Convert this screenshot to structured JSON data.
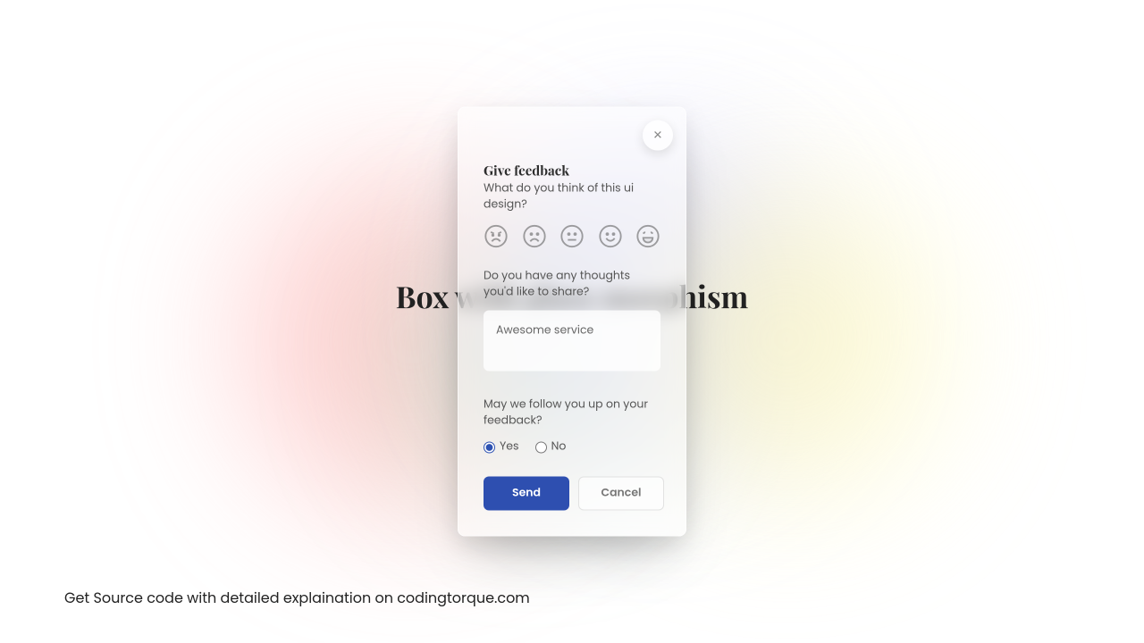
{
  "bg": {
    "title": "Box with glass morphism"
  },
  "modal": {
    "title": "Give feedback",
    "subtitle": "What do you think of this ui design?",
    "thoughts_q": "Do you have any thoughts you'd like to share?",
    "thoughts_value": "Awesome service",
    "followup_q": "May we follow you up on your feedback?",
    "radio": {
      "yes": "Yes",
      "no": "No",
      "selected": "yes"
    },
    "buttons": {
      "send": "Send",
      "cancel": "Cancel"
    },
    "emojis": [
      "angry-face",
      "frown-face",
      "meh-face",
      "smile-face",
      "laugh-face"
    ]
  },
  "footer": "Get Source code with detailed explaination on codingtorque.com"
}
